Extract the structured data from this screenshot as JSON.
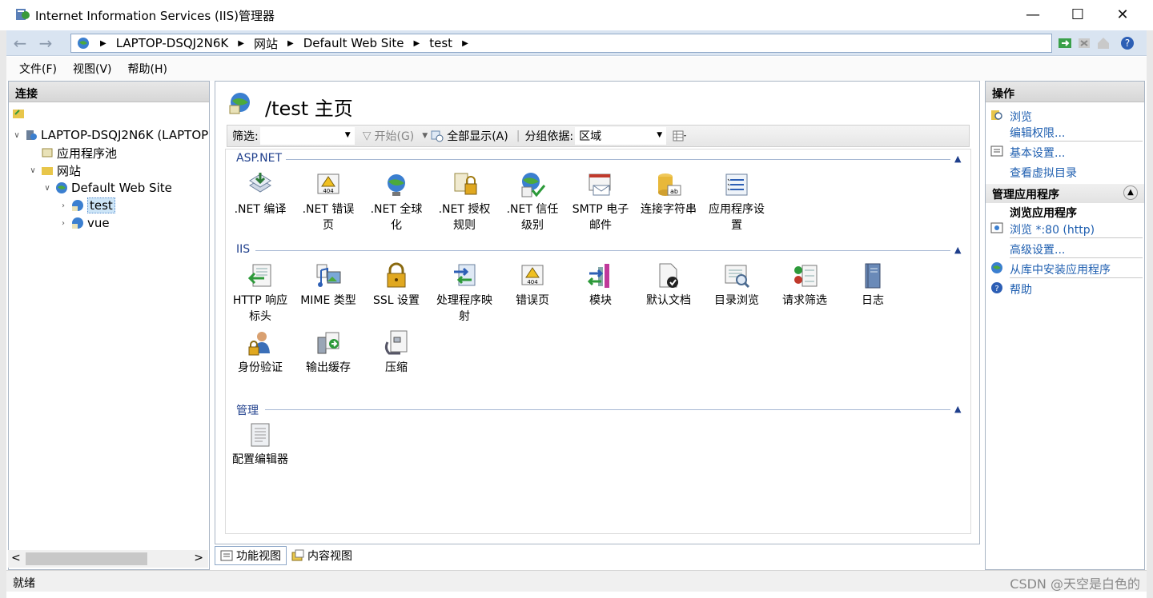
{
  "window": {
    "title": "Internet Information Services (IIS)管理器",
    "min": "—",
    "max": "☐",
    "close": "✕"
  },
  "address": {
    "crumbs": [
      "LAPTOP-DSQJ2N6K",
      "网站",
      "Default Web Site",
      "test"
    ]
  },
  "menu": [
    "文件(F)",
    "视图(V)",
    "帮助(H)"
  ],
  "connections": {
    "header": "连接",
    "tree": [
      {
        "label": "LAPTOP-DSQJ2N6K (LAPTOP",
        "level": 0,
        "twisty": "v"
      },
      {
        "label": "应用程序池",
        "level": 1,
        "twisty": ""
      },
      {
        "label": "网站",
        "level": 1,
        "twisty": "v"
      },
      {
        "label": "Default Web Site",
        "level": 2,
        "twisty": "v"
      },
      {
        "label": "test",
        "level": 3,
        "twisty": ">"
      },
      {
        "label": "vue",
        "level": 3,
        "twisty": ">"
      }
    ]
  },
  "center": {
    "title": "/test 主页",
    "filter": {
      "label": "筛选:",
      "go": "开始(G)",
      "showall": "全部显示(A)",
      "groupby_label": "分组依据:",
      "groupby_value": "区域"
    },
    "groups": [
      {
        "name": "ASP.NET",
        "items": [
          ".NET 编译",
          ".NET 错误\n页",
          ".NET 全球\n化",
          ".NET 授权\n规则",
          ".NET 信任\n级别",
          "SMTP 电子\n邮件",
          "连接字符串",
          "应用程序设\n置"
        ]
      },
      {
        "name": "IIS",
        "items": [
          "HTTP 响应\n标头",
          "MIME 类型",
          "SSL 设置",
          "处理程序映\n射",
          "错误页",
          "模块",
          "默认文档",
          "目录浏览",
          "请求筛选",
          "日志",
          "身份验证",
          "输出缓存",
          "压缩"
        ]
      },
      {
        "name": "管理",
        "items": [
          "配置编辑器"
        ]
      }
    ]
  },
  "viewtabs": {
    "features": "功能视图",
    "content": "内容视图"
  },
  "actions": {
    "header": "操作",
    "browse": "浏览",
    "edit_perm": "编辑权限...",
    "basic": "基本设置...",
    "vdirs": "查看虚拟目录",
    "manage_header": "管理应用程序",
    "browse_app": "浏览应用程序",
    "browse_80": "浏览 *:80 (http)",
    "advanced": "高级设置...",
    "install": "从库中安装应用程序",
    "help": "帮助"
  },
  "status": {
    "text": "就绪",
    "watermark": "CSDN @天空是白色的"
  },
  "colors": {
    "accent": "#1f5fb0",
    "header_blue": "#1f3f8c",
    "address_bg": "#d9e4f1"
  }
}
